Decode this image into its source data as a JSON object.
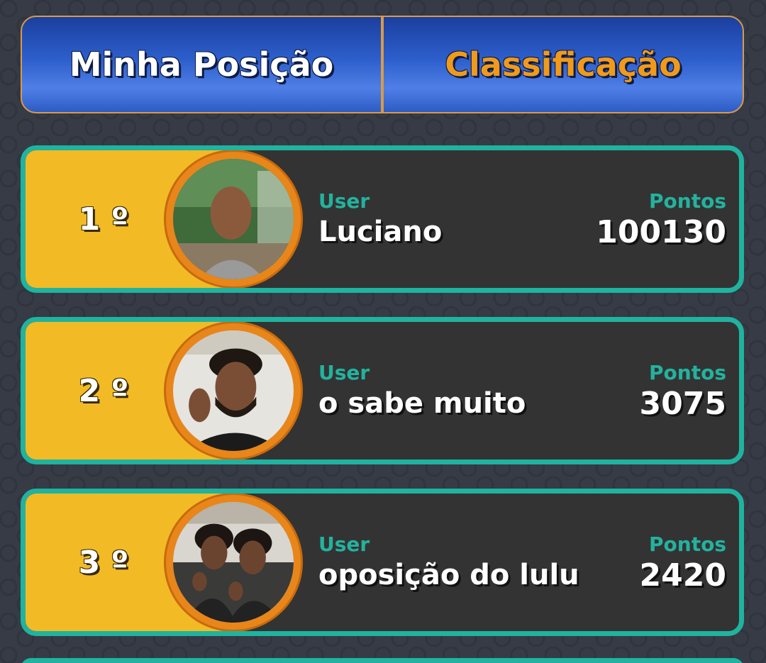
{
  "tabs": {
    "my_position": "Minha Posição",
    "ranking": "Classificação"
  },
  "colors": {
    "accent_active_tab": "#f09a1c",
    "row_border": "#1fb3a0",
    "rank_bg": "#f2bb25",
    "avatar_ring": "#e8861a",
    "label": "#23b29e"
  },
  "ranking": [
    {
      "rank": "1 º",
      "user_label": "User",
      "name": "Luciano",
      "points_label": "Pontos",
      "points": "100130"
    },
    {
      "rank": "2 º",
      "user_label": "User",
      "name": "o sabe muito",
      "points_label": "Pontos",
      "points": "3075"
    },
    {
      "rank": "3 º",
      "user_label": "User",
      "name": "oposição do lulu",
      "points_label": "Pontos",
      "points": "2420"
    }
  ]
}
